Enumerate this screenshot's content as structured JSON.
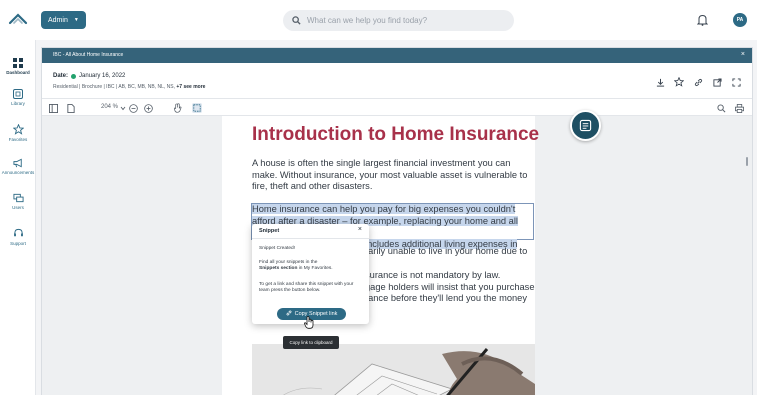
{
  "topbar": {
    "admin_label": "Admin",
    "search_placeholder": "What can we help you find today?",
    "avatar_initials": "PA"
  },
  "sidebar": {
    "items": [
      {
        "label": "Dashboard",
        "icon": "dashboard-icon"
      },
      {
        "label": "Library",
        "icon": "library-icon"
      },
      {
        "label": "Favorites",
        "icon": "star-icon"
      },
      {
        "label": "Announcements",
        "icon": "megaphone-icon"
      },
      {
        "label": "Users",
        "icon": "users-icon"
      },
      {
        "label": "Support",
        "icon": "support-icon"
      }
    ]
  },
  "document": {
    "header_title": "IBC - All About Home Insurance",
    "date_label": "Date:",
    "date_value": "January 16, 2022",
    "tags": "Residential | Brochure | IBC | AB, BC, MB, NB, NL, NS,",
    "tags_more": "+7 see more"
  },
  "toolbar": {
    "zoom_level": "204 %"
  },
  "page": {
    "heading": "Introduction to Home Insurance",
    "para1": "A house is often the single largest financial investment you can make. Without insurance, your most valuable asset is vulnerable to fire, theft and other disasters.",
    "para2_line1": "Home insurance can help you pay for big expenses you couldn't",
    "para2_line2": "afford after a disaster – for example, replacing your home and all your",
    "para2_line3": "includes additional living expenses in",
    "para3": "rarily unable to live in your home due to",
    "para4_line1": "surance is not mandatory by law.",
    "para4_line2": "gage holders will insist that you purchase",
    "para4_line3": "rance before they'll lend you the money"
  },
  "popup": {
    "title": "Snippet",
    "created": "Snippet Created!",
    "find_prefix": "Find all your snippets in the",
    "find_bold": "Snippets section",
    "find_suffix": "in My Favorites.",
    "share_text": "To get a link and share this snippet with your team press the button below.",
    "copy_button": "Copy Snippet link",
    "tooltip": "Copy link to clipboard"
  },
  "colors": {
    "accent": "#2d6a85",
    "header": "#35637a",
    "heading_red": "#a8314a",
    "highlight": "#c6d6ec"
  }
}
